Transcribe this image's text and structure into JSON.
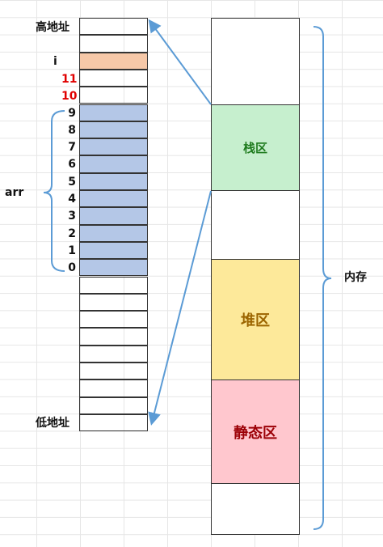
{
  "labels": {
    "high_address": "高地址",
    "low_address": "低地址",
    "i": "i",
    "eleven": "11",
    "ten": "10",
    "arr": "arr",
    "memory": "内存"
  },
  "array_indices": [
    "9",
    "8",
    "7",
    "6",
    "5",
    "4",
    "3",
    "2",
    "1",
    "0"
  ],
  "regions": {
    "stack": "栈区",
    "heap": "堆区",
    "static": "静态区"
  },
  "colors": {
    "cell_i": "#f6c8a8",
    "cell_arr": "#b4c7e7",
    "stack_fill": "#c6efce",
    "stack_text": "#1e7b1e",
    "heap_fill": "#fde99a",
    "heap_text": "#9c6500",
    "static_fill": "#ffc7ce",
    "static_text": "#9c0006",
    "arrow": "#5b9bd5"
  }
}
